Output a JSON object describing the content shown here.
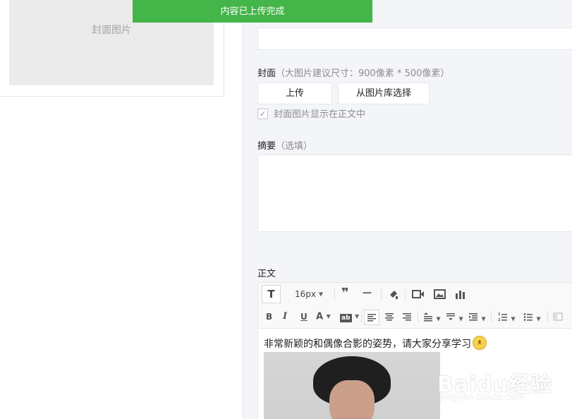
{
  "toast": {
    "message": "内容已上传完成"
  },
  "left": {
    "cover_placeholder": "封面图片"
  },
  "form": {
    "author_value": "",
    "cover_label": "封面",
    "cover_hint": "（大图片建议尺寸：900像素 * 500像素）",
    "upload_button": "上传",
    "library_button": "从图片库选择",
    "show_cover_checked": true,
    "show_cover_label": "封面图片显示在正文中",
    "summary_label": "摘要",
    "summary_hint": "（选填）",
    "summary_value": "",
    "body_label": "正文"
  },
  "editor": {
    "font_size": "16px",
    "content_text": "非常新颖的和偶像合影的姿势，请大家分享学习",
    "toolbar_icons": [
      "text-format-icon",
      "font-size-select",
      "quote-icon",
      "horizontal-rule-icon",
      "format-painter-icon",
      "video-icon",
      "image-icon",
      "chart-icon",
      "bold-icon",
      "italic-icon",
      "underline-icon",
      "font-color-icon",
      "highlight-icon",
      "align-left-icon",
      "align-center-icon",
      "align-right-icon",
      "line-height-icon",
      "paragraph-spacing-icon",
      "indent-icon",
      "ordered-list-icon",
      "unordered-list-icon",
      "table-icon"
    ]
  },
  "watermark": {
    "logo": "Baidu经验",
    "url": "jingyan.baidu.com"
  },
  "colors": {
    "accent": "#44b549",
    "panel_bg": "#f4f5f9",
    "border": "#e4e8eb"
  }
}
